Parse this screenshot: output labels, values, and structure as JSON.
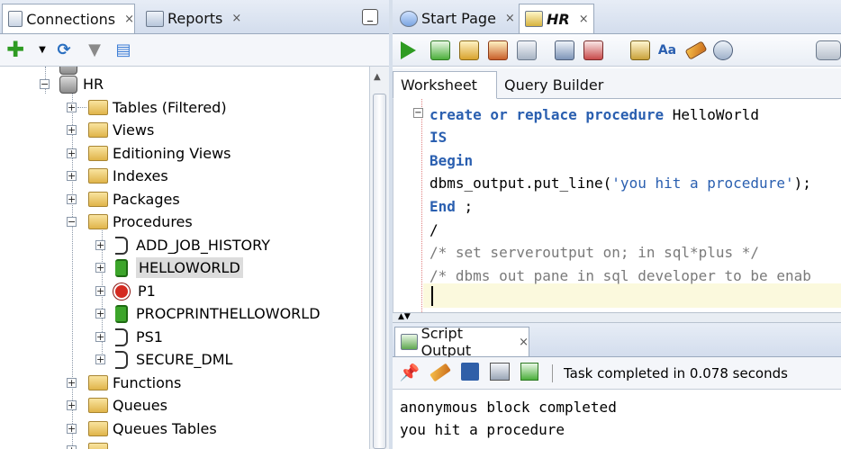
{
  "left_panel": {
    "tabs": [
      {
        "label": "Connections",
        "close": "×",
        "icon": "connections-icon"
      },
      {
        "label": "Reports",
        "close": "×",
        "icon": "reports-icon"
      }
    ],
    "minimize_icon": "minimize-icon",
    "toolbar": [
      "add-icon",
      "dropdown-arrow-icon",
      "refresh-icon",
      "filter-icon",
      "schema-browser-icon"
    ],
    "tree": {
      "connection": "HR",
      "nodes": [
        {
          "label": "Tables (Filtered)",
          "icon": "tables-folder-icon"
        },
        {
          "label": "Views",
          "icon": "views-folder-icon"
        },
        {
          "label": "Editioning Views",
          "icon": "editioning-views-folder-icon"
        },
        {
          "label": "Indexes",
          "icon": "indexes-folder-icon"
        },
        {
          "label": "Packages",
          "icon": "packages-folder-icon"
        },
        {
          "label": "Procedures",
          "icon": "procedures-folder-icon",
          "expanded": true,
          "children": [
            {
              "label": "ADD_JOB_HISTORY",
              "status": "normal"
            },
            {
              "label": "HELLOWORLD",
              "status": "ok",
              "selected": true
            },
            {
              "label": "P1",
              "status": "error"
            },
            {
              "label": "PROCPRINTHELLOWORLD",
              "status": "ok"
            },
            {
              "label": "PS1",
              "status": "normal"
            },
            {
              "label": "SECURE_DML",
              "status": "normal"
            }
          ]
        },
        {
          "label": "Functions",
          "icon": "functions-folder-icon"
        },
        {
          "label": "Queues",
          "icon": "queues-folder-icon"
        },
        {
          "label": "Queues Tables",
          "icon": "queues-tables-folder-icon"
        }
      ]
    }
  },
  "right_panel": {
    "tabs": [
      {
        "label": "Start Page",
        "close": "×",
        "icon": "help-icon"
      },
      {
        "label": "HR",
        "close": "×",
        "icon": "sql-worksheet-icon",
        "active": true
      }
    ],
    "worksheet_tabs": [
      "Worksheet",
      "Query Builder"
    ],
    "code_lines": [
      {
        "parts": [
          {
            "t": "create or replace procedure",
            "c": "kw"
          },
          {
            "t": " HelloWorld",
            "c": ""
          }
        ]
      },
      {
        "parts": [
          {
            "t": "IS",
            "c": "kw"
          }
        ]
      },
      {
        "parts": [
          {
            "t": "Begin",
            "c": "kw"
          }
        ]
      },
      {
        "parts": [
          {
            "t": "dbms_output.put_line(",
            "c": ""
          },
          {
            "t": "'you hit a procedure'",
            "c": "str"
          },
          {
            "t": ");",
            "c": ""
          }
        ]
      },
      {
        "parts": [
          {
            "t": "End",
            "c": "kw"
          },
          {
            "t": " ;",
            "c": ""
          }
        ]
      },
      {
        "parts": [
          {
            "t": "/",
            "c": ""
          }
        ]
      },
      {
        "parts": [
          {
            "t": "/* set serveroutput on; in sql*plus */",
            "c": "cm"
          }
        ]
      },
      {
        "parts": [
          {
            "t": "/* dbms out pane in sql developer to be enab",
            "c": "cm"
          }
        ]
      }
    ],
    "output": {
      "tab_label": "Script Output",
      "close": "×",
      "status": "Task completed in 0.078 seconds",
      "lines": [
        "anonymous block completed",
        "you hit a procedure"
      ]
    }
  },
  "colors": {
    "keyword": "#2a5fb0",
    "comment": "#7a7a7a",
    "current_line": "#fbf9dd",
    "selection": "#dcdcdc"
  }
}
